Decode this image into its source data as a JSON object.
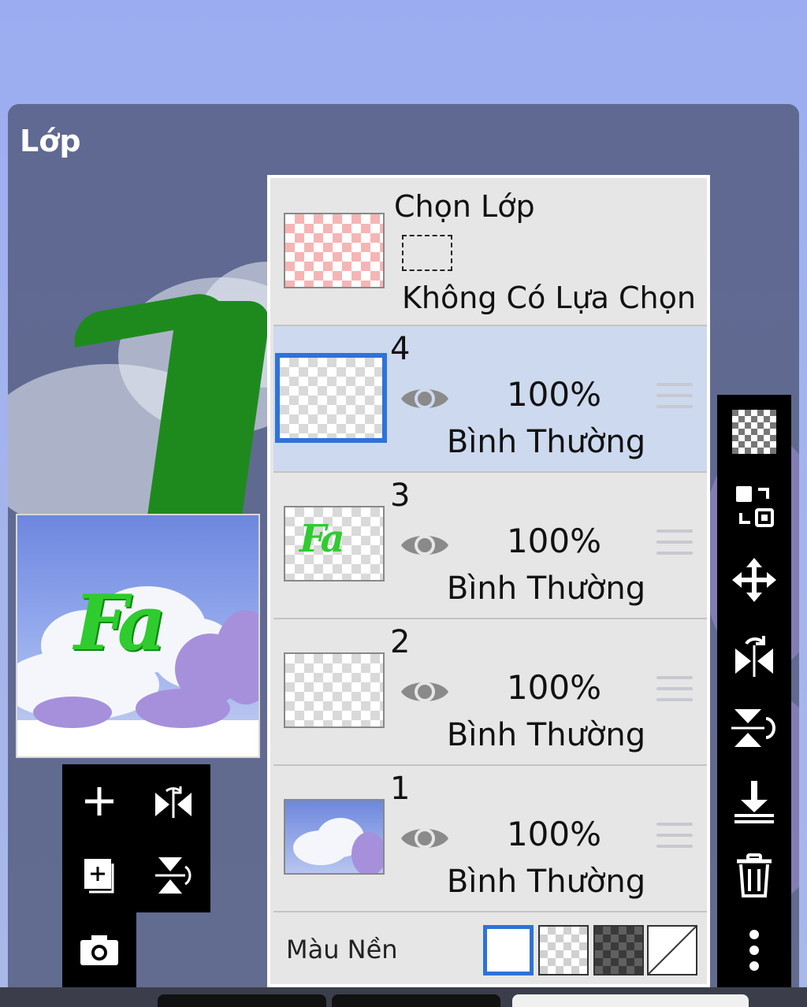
{
  "panel": {
    "title": "Lớp"
  },
  "selection": {
    "title": "Chọn Lớp",
    "subtitle": "Không Có Lựa Chọn"
  },
  "layers": [
    {
      "number": "4",
      "opacity": "100%",
      "blend": "Bình Thường",
      "selected": true
    },
    {
      "number": "3",
      "opacity": "100%",
      "blend": "Bình Thường",
      "selected": false
    },
    {
      "number": "2",
      "opacity": "100%",
      "blend": "Bình Thường",
      "selected": false
    },
    {
      "number": "1",
      "opacity": "100%",
      "blend": "Bình Thường",
      "selected": false
    }
  ],
  "background_color": {
    "label": "Màu Nền",
    "options": [
      "white",
      "transparent",
      "dark",
      "none"
    ],
    "selected": "white"
  },
  "thumbnails": {
    "layer3_text": "Fa"
  },
  "preview": {
    "logo_text": "Fa"
  },
  "left_toolbar": [
    "add-layer-icon",
    "rotate-flip-horizontal-icon",
    "add-copy-layer-icon",
    "rotate-flip-vertical-icon",
    "camera-icon"
  ],
  "right_toolbar": [
    "checkerboard-icon",
    "swap-layers-icon",
    "move-icon",
    "flip-horizontal-icon",
    "flip-vertical-icon",
    "merge-down-icon",
    "trash-icon",
    "more-icon"
  ],
  "colors": {
    "accent": "#2f72d8",
    "selected_row": "#cdd9ee",
    "panel_bg": "#e6e6e6"
  }
}
